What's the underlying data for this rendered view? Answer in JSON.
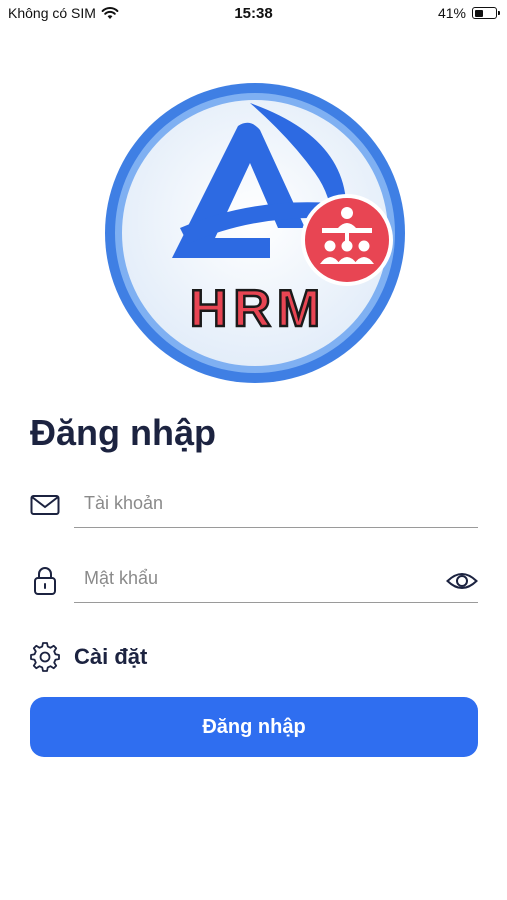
{
  "status_bar": {
    "carrier": "Không có SIM",
    "time": "15:38",
    "battery_percent": "41%",
    "battery_level": 0.41
  },
  "logo": {
    "text": "HRM",
    "icon": "app-logo"
  },
  "login": {
    "title": "Đăng nhập",
    "username_placeholder": "Tài khoản",
    "username_value": "",
    "password_placeholder": "Mật khẩu",
    "password_value": "",
    "settings_label": "Cài đặt",
    "submit_label": "Đăng nhập"
  },
  "colors": {
    "accent": "#2f6ef0",
    "title": "#1c2340",
    "logo_ring": "#4a86e8",
    "logo_red": "#e84553"
  }
}
